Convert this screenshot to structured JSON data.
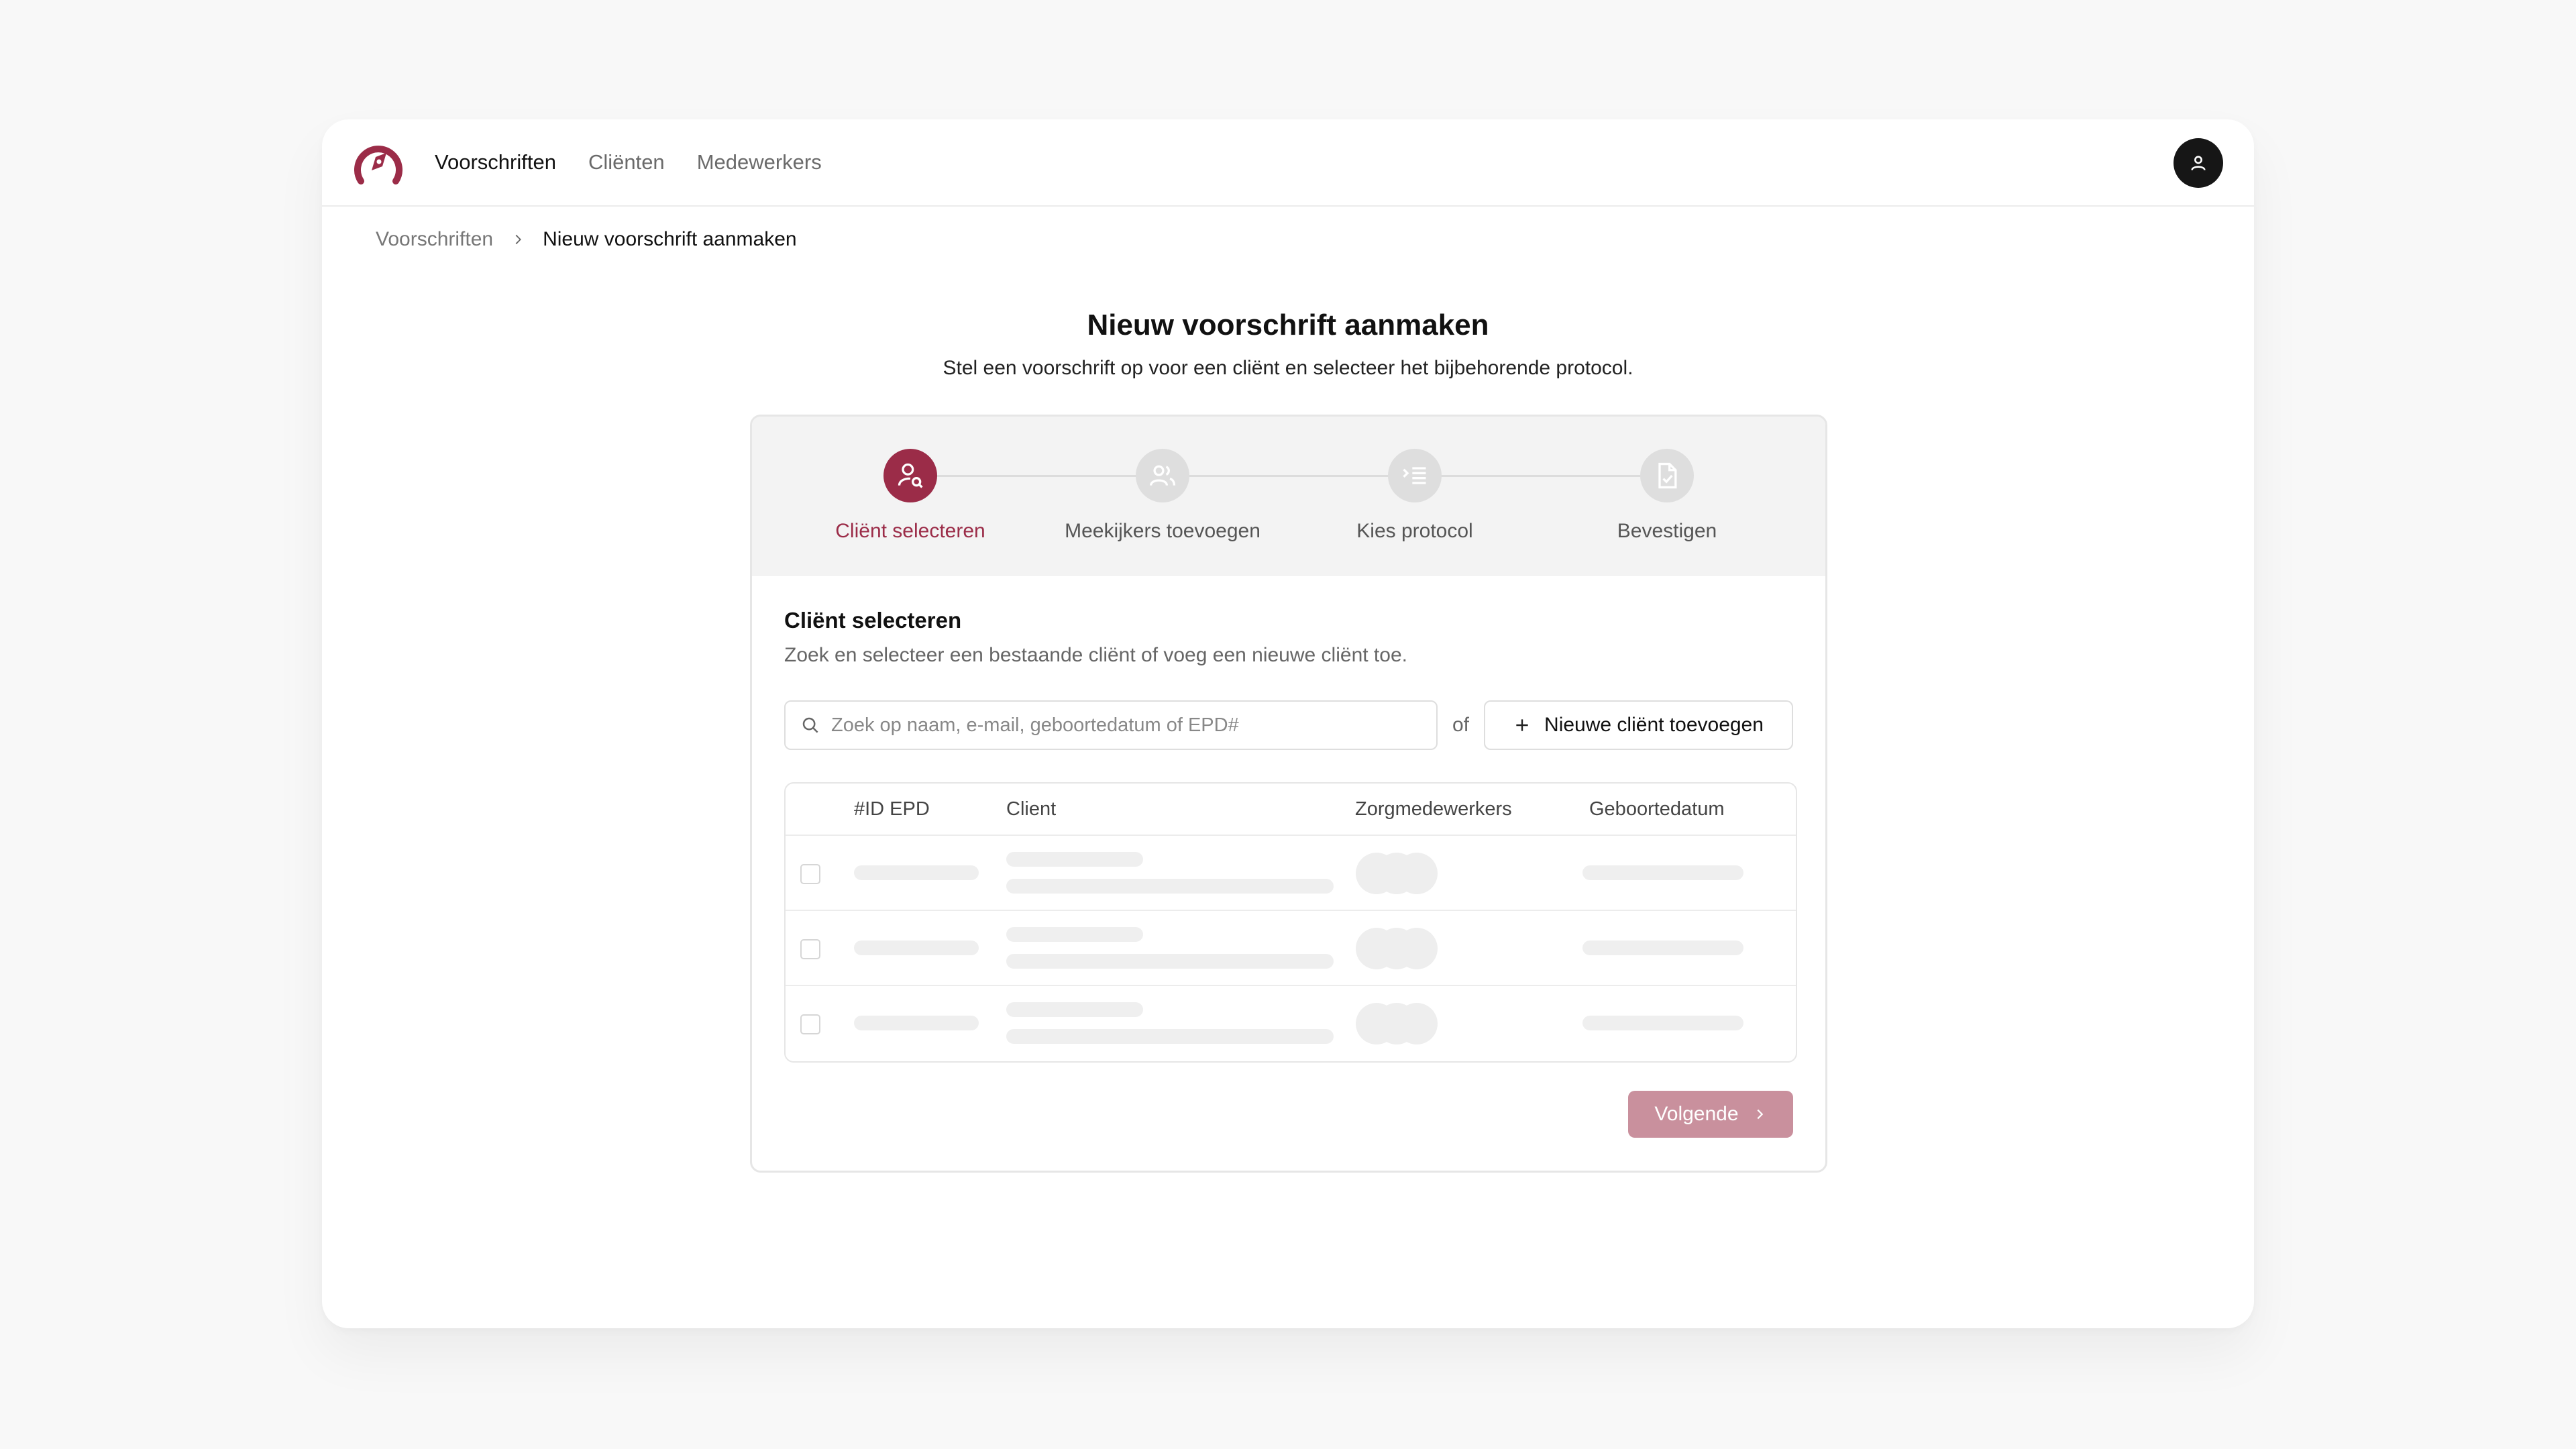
{
  "nav": {
    "items": [
      {
        "label": "Voorschriften",
        "active": true
      },
      {
        "label": "Cliënten",
        "active": false
      },
      {
        "label": "Medewerkers",
        "active": false
      }
    ],
    "avatar_icon": "user-icon"
  },
  "breadcrumb": {
    "parent": "Voorschriften",
    "current": "Nieuw voorschrift aanmaken"
  },
  "page": {
    "title": "Nieuw voorschrift aanmaken",
    "subtitle": "Stel een voorschrift op voor een cliënt en selecteer het bijbehorende protocol."
  },
  "steps": [
    {
      "label": "Cliënt selecteren",
      "icon": "user-search-icon",
      "active": true
    },
    {
      "label": "Meekijkers toevoegen",
      "icon": "users-icon",
      "active": false
    },
    {
      "label": "Kies protocol",
      "icon": "list-icon",
      "active": false
    },
    {
      "label": "Bevestigen",
      "icon": "file-check-icon",
      "active": false
    }
  ],
  "section": {
    "title": "Cliënt selecteren",
    "description": "Zoek en selecteer een bestaande cliënt of voeg een nieuwe cliënt toe."
  },
  "search": {
    "placeholder": "Zoek op naam, e-mail, geboortedatum of EPD#",
    "value": "",
    "or_label": "of",
    "add_button": "Nieuwe cliënt toevoegen"
  },
  "table": {
    "columns": [
      "#ID EPD",
      "Client",
      "Zorgmedewerkers",
      "Geboortedatum"
    ]
  },
  "actions": {
    "next_label": "Volgende"
  },
  "colors": {
    "accent": "#9b2c48",
    "accent_disabled": "#c9909d"
  }
}
